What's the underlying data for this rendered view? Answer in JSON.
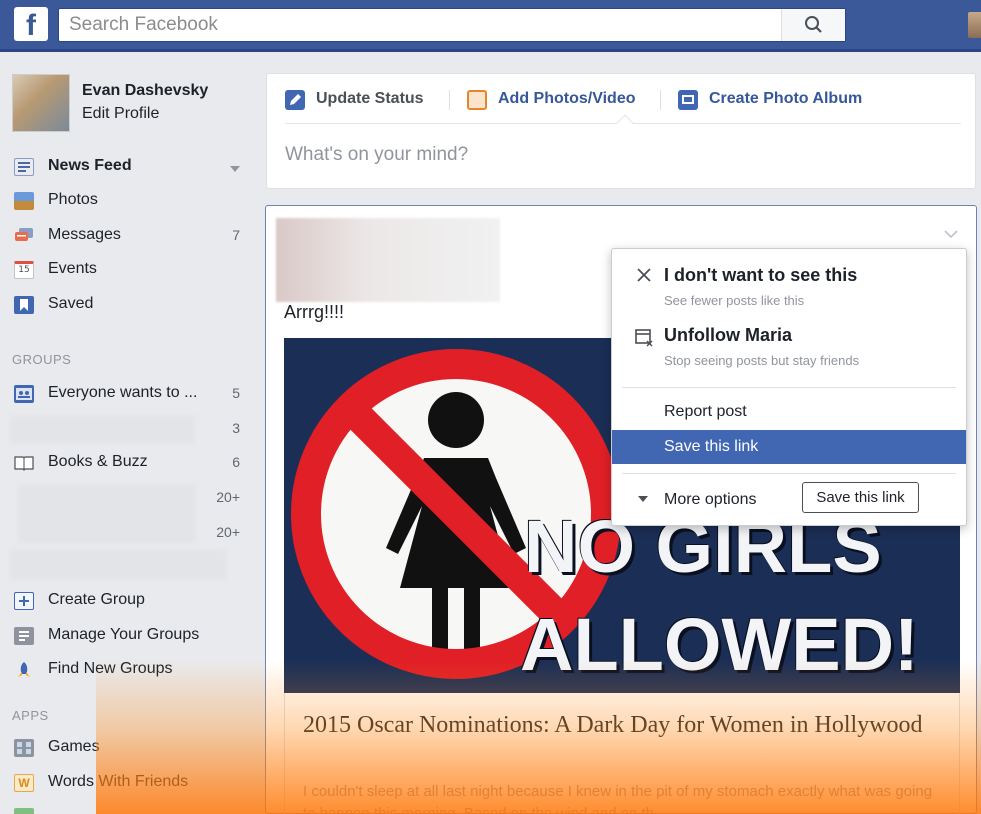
{
  "header": {
    "logo": "f",
    "search_placeholder": "Search Facebook"
  },
  "profile": {
    "name": "Evan Dashevsky",
    "edit_label": "Edit Profile"
  },
  "nav": {
    "items": [
      {
        "label": "News Feed",
        "count": ""
      },
      {
        "label": "Photos",
        "count": ""
      },
      {
        "label": "Messages",
        "count": "7"
      },
      {
        "label": "Events",
        "count": ""
      },
      {
        "label": "Saved",
        "count": ""
      }
    ],
    "events_icon_text": "15"
  },
  "groups": {
    "header": "GROUPS",
    "items": [
      {
        "label": "Everyone wants to ...",
        "count": "5"
      },
      {
        "label": "",
        "count": "3"
      },
      {
        "label": "Books & Buzz",
        "count": "6"
      },
      {
        "label": "",
        "count": "20+"
      },
      {
        "label": "",
        "count": "20+"
      }
    ],
    "actions": [
      "Create Group",
      "Manage Your Groups",
      "Find New Groups"
    ]
  },
  "apps": {
    "header": "APPS",
    "items": [
      "Games",
      "Words With Friends"
    ]
  },
  "composer": {
    "tabs": [
      "Update Status",
      "Add Photos/Video",
      "Create Photo Album"
    ],
    "placeholder": "What's on your mind?"
  },
  "post": {
    "text": "Arrrg!!!!",
    "image_line1": "NO GIRLS",
    "image_line2": "ALLOWED!",
    "link_title": "2015 Oscar Nominations: A Dark Day for Women in Hollywood",
    "link_description": "I couldn't sleep at all last night because I knew in the pit of my stomach exactly what was going to happen this morning. Based on the wind and on th..."
  },
  "menu": {
    "hide_title": "I don't want to see this",
    "hide_sub": "See fewer posts like this",
    "unfollow_title": "Unfollow Maria",
    "unfollow_sub": "Stop seeing posts but stay friends",
    "report": "Report post",
    "save": "Save this link",
    "more": "More options",
    "save_tooltip": "Save this link"
  },
  "colors": {
    "brand": "#3b5998",
    "menu_highlight": "#4267b2",
    "overlay": "#ff8c1e"
  }
}
